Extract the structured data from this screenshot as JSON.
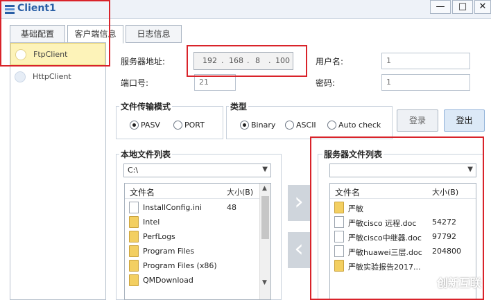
{
  "window": {
    "title": "Client1",
    "minimize": "—",
    "maximize": "□",
    "close": "✕"
  },
  "tabs": [
    "基础配置",
    "客户端信息",
    "日志信息"
  ],
  "sidebar": {
    "items": [
      {
        "label": "FtpClient"
      },
      {
        "label": "HttpClient"
      }
    ]
  },
  "connection": {
    "server_label": "服务器地址:",
    "ip": [
      "192",
      "168",
      "8",
      "100"
    ],
    "ip_sep": ".",
    "user_label": "用户名:",
    "user_value": "1",
    "port_label": "端口号:",
    "port_value": "21",
    "password_label": "密码:",
    "password_value": "1"
  },
  "transfer_mode": {
    "title": "文件传输模式",
    "options": [
      "PASV",
      "PORT"
    ],
    "selected": "PASV"
  },
  "type": {
    "title": "类型",
    "options": [
      "Binary",
      "ASCII",
      "Auto check"
    ],
    "selected": "Binary"
  },
  "buttons": {
    "login": "登录",
    "logout": "登出"
  },
  "local": {
    "title": "本地文件列表",
    "path": "C:\\",
    "col_name": "文件名",
    "col_size": "大小(B)",
    "files": [
      {
        "name": "InstallConfig.ini",
        "size": "48",
        "kind": "file"
      },
      {
        "name": "Intel",
        "size": "",
        "kind": "folder"
      },
      {
        "name": "PerfLogs",
        "size": "",
        "kind": "folder"
      },
      {
        "name": "Program Files",
        "size": "",
        "kind": "folder"
      },
      {
        "name": "Program Files (x86)",
        "size": "",
        "kind": "folder"
      },
      {
        "name": "QMDownload",
        "size": "",
        "kind": "folder"
      }
    ]
  },
  "remote": {
    "title": "服务器文件列表",
    "path": "",
    "col_name": "文件名",
    "col_size": "大小(B)",
    "files": [
      {
        "name": "严敏",
        "size": "",
        "kind": "folder"
      },
      {
        "name": "严敏cisco 远程.doc",
        "size": "54272",
        "kind": "file"
      },
      {
        "name": "严敏cisco中继器.doc",
        "size": "97792",
        "kind": "file"
      },
      {
        "name": "严敏huawei三层.doc",
        "size": "204800",
        "kind": "file"
      },
      {
        "name": "严敏实验报告2017...",
        "size": "",
        "kind": "folder"
      }
    ]
  },
  "arrows": {
    "upload": "›",
    "download": "‹"
  },
  "watermark": "创新互联"
}
